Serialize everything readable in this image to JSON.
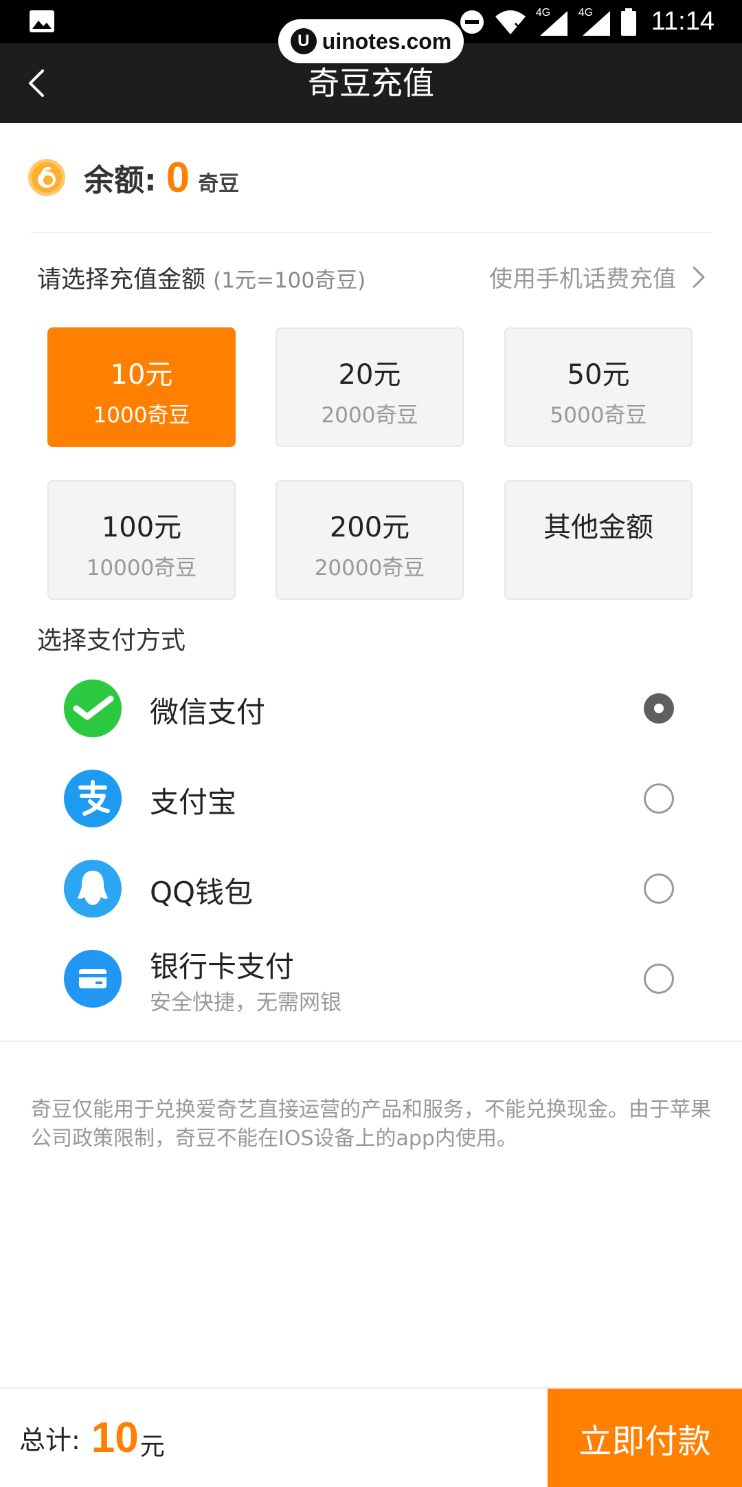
{
  "status_bar": {
    "time": "11:14",
    "network_1": "4G",
    "network_2": "4G",
    "icons": [
      "gallery-icon",
      "dnd-icon",
      "wifi-icon",
      "signal-icon",
      "battery-icon"
    ]
  },
  "watermark": {
    "text": "uinotes.com",
    "logo_letter": "U"
  },
  "navbar": {
    "title": "奇豆充值",
    "back_icon": "back-arrow-icon"
  },
  "balance": {
    "label": "余额:",
    "amount": "0",
    "unit": "奇豆"
  },
  "recharge": {
    "title": "请选择充值金额",
    "hint": "(1元=100奇豆)",
    "phone_link": "使用手机话费充值",
    "options": [
      {
        "yuan": "10元",
        "beans": "1000奇豆",
        "selected": true
      },
      {
        "yuan": "20元",
        "beans": "2000奇豆",
        "selected": false
      },
      {
        "yuan": "50元",
        "beans": "5000奇豆",
        "selected": false
      },
      {
        "yuan": "100元",
        "beans": "10000奇豆",
        "selected": false
      },
      {
        "yuan": "200元",
        "beans": "20000奇豆",
        "selected": false
      },
      {
        "yuan": "其他金额",
        "beans": "",
        "selected": false
      }
    ]
  },
  "payment": {
    "title": "选择支付方式",
    "methods": [
      {
        "name": "微信支付",
        "icon": "wechat-pay-icon",
        "selected": true
      },
      {
        "name": "支付宝",
        "icon": "alipay-icon",
        "selected": false
      },
      {
        "name": "QQ钱包",
        "icon": "qq-wallet-icon",
        "selected": false
      },
      {
        "name": "银行卡支付",
        "subtitle": "安全快捷，无需网银",
        "icon": "bank-card-icon",
        "selected": false
      }
    ]
  },
  "notice": "奇豆仅能用于兑换爱奇艺直接运营的产品和服务，不能兑换现金。由于苹果公司政策限制，奇豆不能在IOS设备上的app内使用。",
  "footer": {
    "total_label": "总计:",
    "total_amount": "10",
    "total_unit": "元",
    "pay_button": "立即付款"
  },
  "colors": {
    "accent": "#ff7f00",
    "navbar": "#1d1d1d",
    "wechat": "#2ac940",
    "alipay": "#1d9bf0",
    "qq": "#2aa6f2",
    "bank": "#2196f3"
  }
}
